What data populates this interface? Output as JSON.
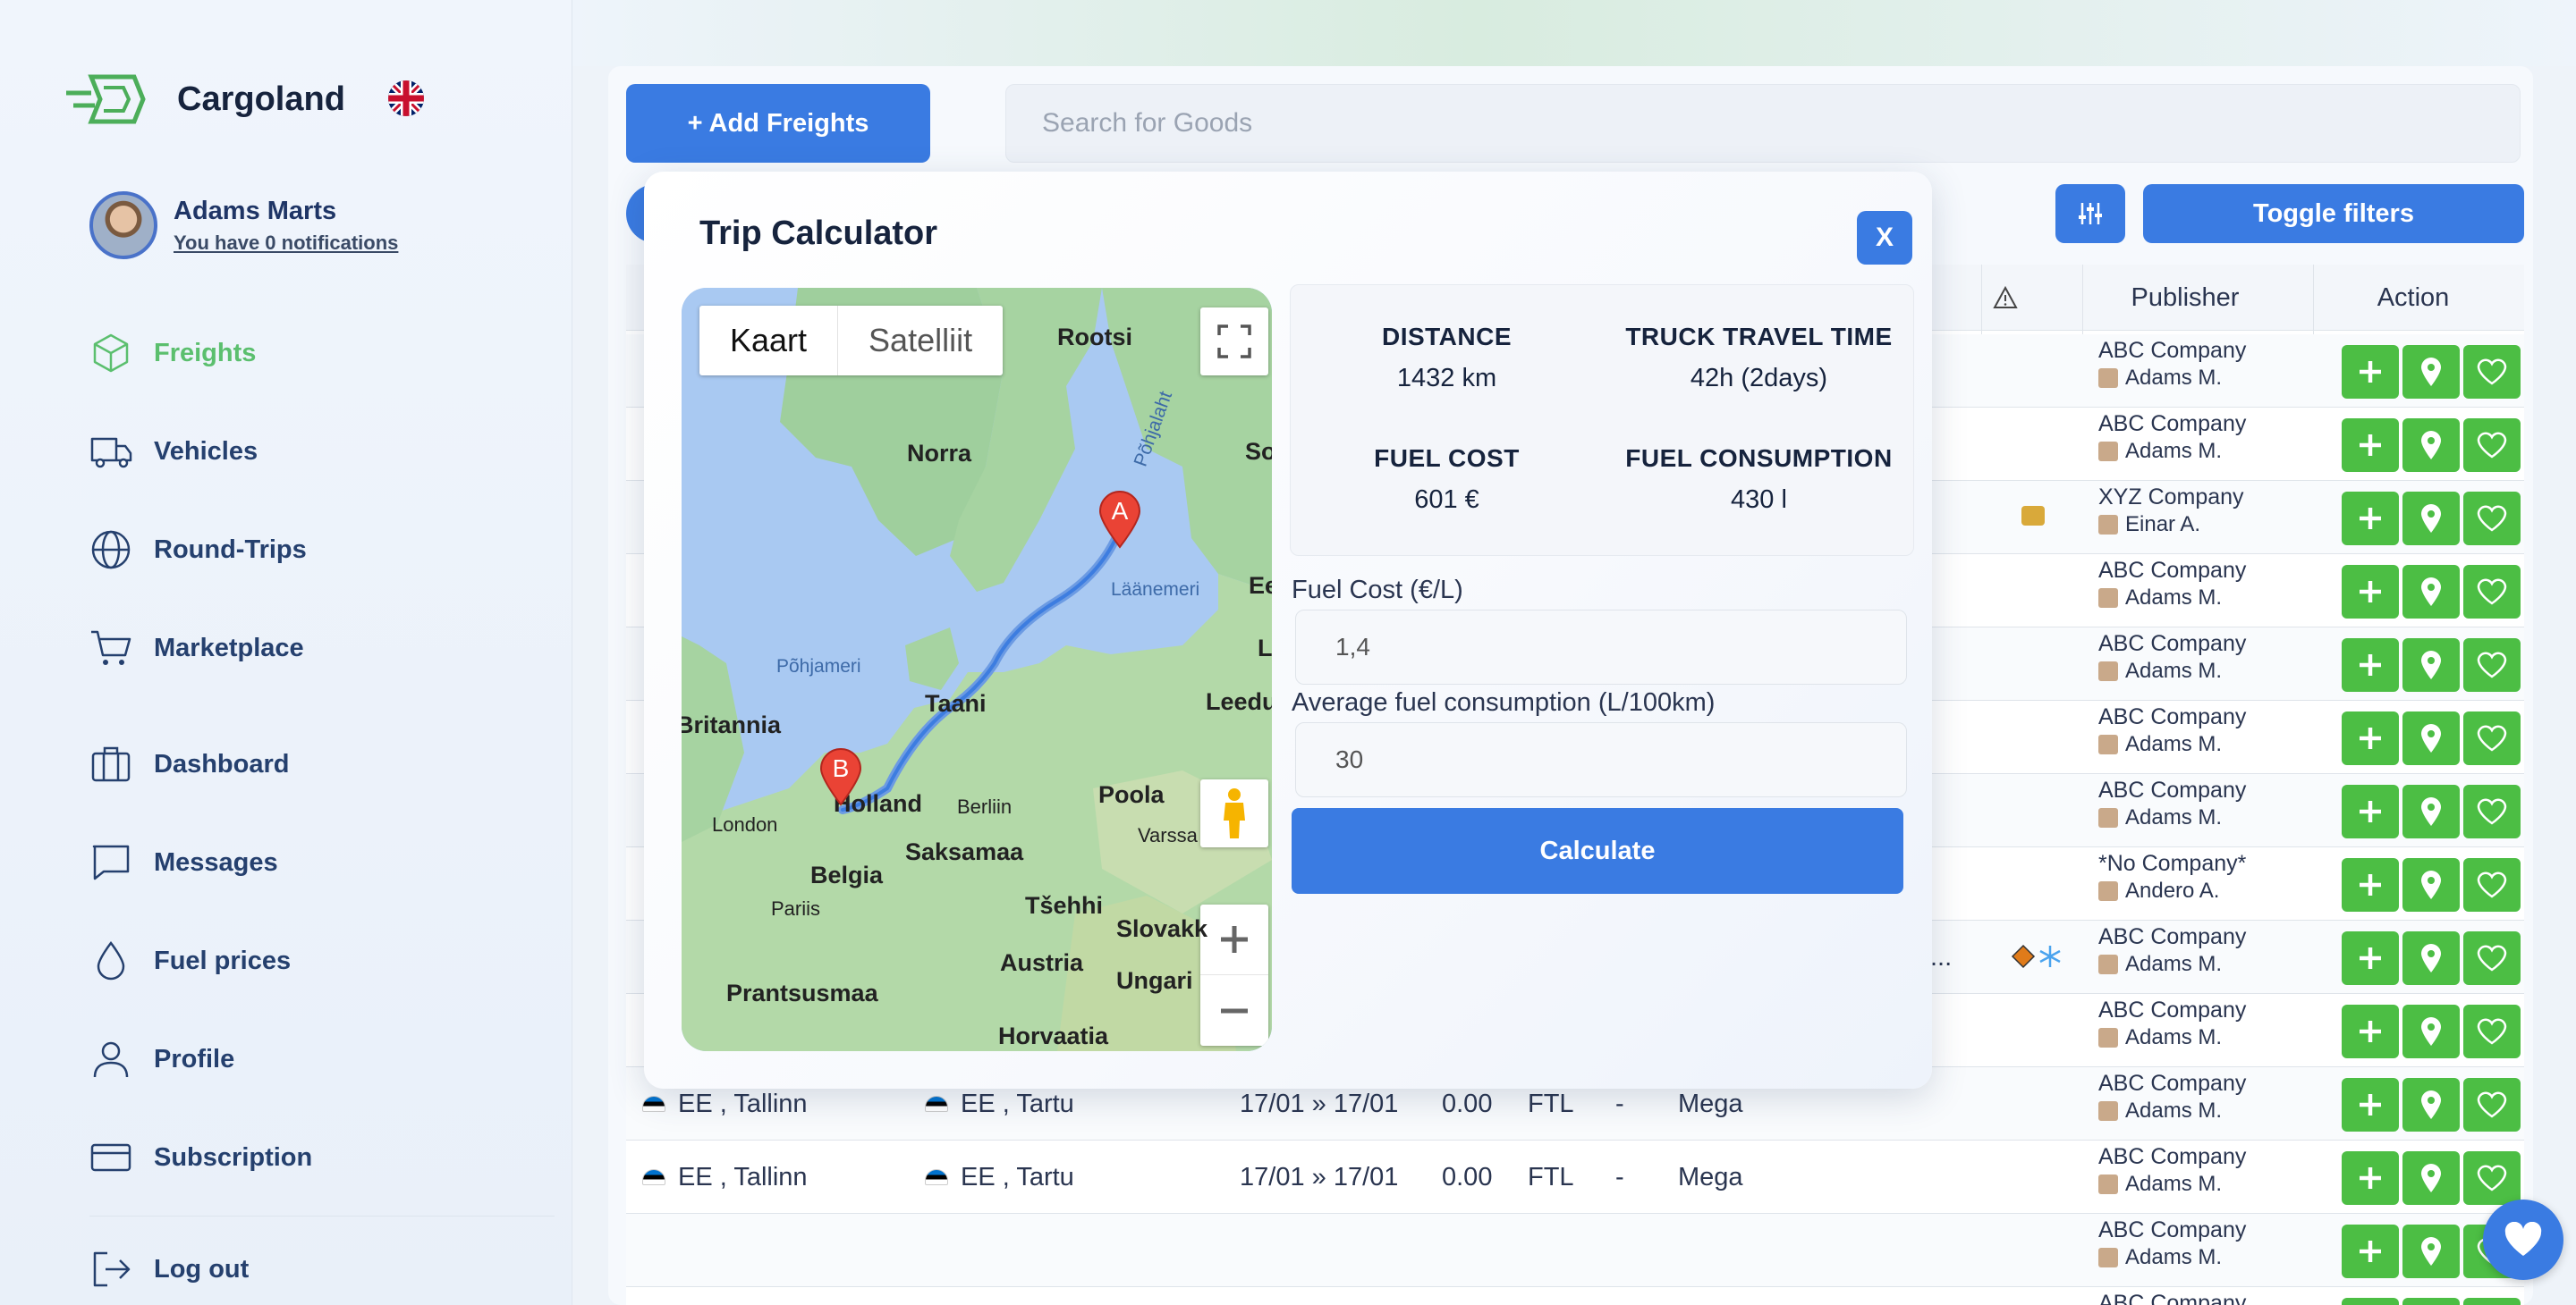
{
  "brand": {
    "name": "Cargoland"
  },
  "user": {
    "name": "Adams Marts",
    "notifications": "You have 0 notifications"
  },
  "nav": {
    "freights": "Freights",
    "vehicles": "Vehicles",
    "round_trips": "Round-Trips",
    "marketplace": "Marketplace",
    "dashboard": "Dashboard",
    "messages": "Messages",
    "fuel_prices": "Fuel prices",
    "profile": "Profile",
    "subscription": "Subscription",
    "logout": "Log out"
  },
  "toolbar": {
    "add_freights": "+ Add Freights",
    "search_placeholder": "Search for Goods",
    "toggle_filters": "Toggle filters"
  },
  "table": {
    "headers": {
      "publisher": "Publisher",
      "action": "Action"
    },
    "publishers": [
      {
        "company": "ABC Company",
        "user": "Adams M."
      },
      {
        "company": "ABC Company",
        "user": "Adams M."
      },
      {
        "company": "XYZ Company",
        "user": "Einar A."
      },
      {
        "company": "ABC Company",
        "user": "Adams M."
      },
      {
        "company": "ABC Company",
        "user": "Adams M."
      },
      {
        "company": "ABC Company",
        "user": "Adams M."
      },
      {
        "company": "ABC Company",
        "user": "Adams M."
      },
      {
        "company": "*No Company*",
        "user": "Andero A."
      },
      {
        "company": "ABC Company",
        "user": "Adams M."
      },
      {
        "company": "ABC Company",
        "user": "Adams M."
      },
      {
        "company": "ABC Company",
        "user": "Adams M."
      },
      {
        "company": "ABC Company",
        "user": "Adams M."
      },
      {
        "company": "ABC Company",
        "user": "Adams M."
      },
      {
        "company": "ABC Company",
        "user": ""
      }
    ],
    "route_rows": [
      {
        "from": "EE , Tallinn",
        "to": "EE , Tartu",
        "dates": "17/01 » 17/01",
        "price": "0.00",
        "type": "FTL",
        "dash": "-",
        "truck": "Mega"
      },
      {
        "from": "EE , Tallinn",
        "to": "EE , Tartu",
        "dates": "17/01 » 17/01",
        "price": "0.00",
        "type": "FTL",
        "dash": "-",
        "truck": "Mega"
      }
    ],
    "partial_row": {
      "from": "EE , Tallinn",
      "to": "EE , Tartu",
      "dates": "17/01 » 17/01",
      "price": "0.00",
      "type": "FTL",
      "truck": "Mega"
    },
    "ellipsis": "..."
  },
  "modal": {
    "title": "Trip Calculator",
    "close": "X",
    "map": {
      "tab_map": "Kaart",
      "tab_satellite": "Satelliit",
      "labels": {
        "rootsi": "Rootsi",
        "norra": "Norra",
        "so": "So",
        "pohjalaht": "Põhjalaht",
        "laanemeri": "Läänemeri",
        "ee": "Ee",
        "l": "L",
        "leedu": "Leedu",
        "pohjameri": "Põhjameri",
        "britannia": "Britannia",
        "taani": "Taani",
        "london": "London",
        "holland": "Holland",
        "berliin": "Berliin",
        "poola": "Poola",
        "varssa": "Varssa",
        "belgia": "Belgia",
        "saksamaa": "Saksamaa",
        "pariis": "Pariis",
        "tsehhi": "Tšehhi",
        "slovakk": "Slovakk",
        "austria": "Austria",
        "ungari": "Ungari",
        "prantsusmaa": "Prantsusmaa",
        "horvaatia": "Horvaatia"
      },
      "marker_a": "A",
      "marker_b": "B"
    },
    "stats": {
      "distance_label": "DISTANCE",
      "distance": "1432 km",
      "time_label": "TRUCK TRAVEL TIME",
      "time": "42h (2days)",
      "fuel_cost_label": "FUEL COST",
      "fuel_cost": "601 €",
      "fuel_cons_label": "FUEL CONSUMPTION",
      "fuel_cons": "430 l"
    },
    "form": {
      "fuel_cost_label": "Fuel Cost (€/L)",
      "fuel_cost_value": "1,4",
      "avg_label": "Average fuel consumption (L/100km)",
      "avg_value": "30",
      "calculate": "Calculate"
    }
  },
  "colors": {
    "accent": "#3a7be2",
    "green": "#4cbe44",
    "active_nav": "#5bbf6e"
  }
}
